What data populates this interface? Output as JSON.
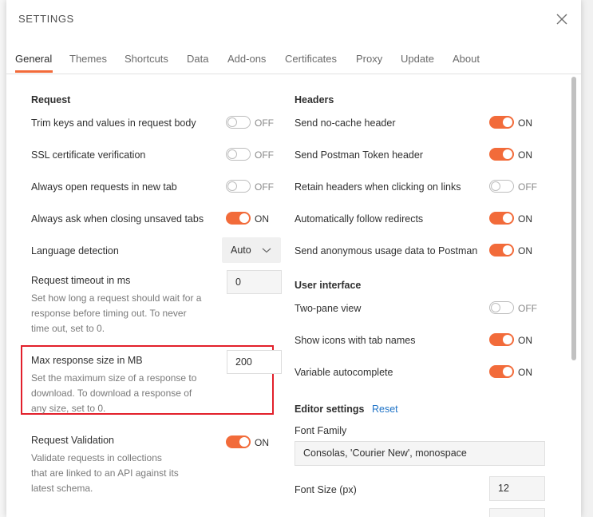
{
  "modal": {
    "title": "SETTINGS"
  },
  "tabs": [
    {
      "label": "General",
      "active": true
    },
    {
      "label": "Themes"
    },
    {
      "label": "Shortcuts"
    },
    {
      "label": "Data"
    },
    {
      "label": "Add-ons"
    },
    {
      "label": "Certificates"
    },
    {
      "label": "Proxy"
    },
    {
      "label": "Update"
    },
    {
      "label": "About"
    }
  ],
  "request": {
    "title": "Request",
    "trim_keys": {
      "label": "Trim keys and values in request body",
      "state": "OFF"
    },
    "ssl": {
      "label": "SSL certificate verification",
      "state": "OFF"
    },
    "new_tab": {
      "label": "Always open requests in new tab",
      "state": "OFF"
    },
    "ask_close": {
      "label": "Always ask when closing unsaved tabs",
      "state": "ON"
    },
    "language": {
      "label": "Language detection",
      "value": "Auto"
    },
    "timeout": {
      "label": "Request timeout in ms",
      "value": "0",
      "desc": [
        "Set how long a request should wait for a",
        "response before timing out. To never",
        "time out, set to 0."
      ]
    },
    "max_response": {
      "label": "Max response size in MB",
      "value": "200",
      "desc": [
        "Set the maximum size of a response to",
        "download. To download a response of",
        "any size, set to 0."
      ]
    },
    "validation": {
      "label": "Request Validation",
      "state": "ON",
      "desc": [
        "Validate requests in collections",
        "that are linked to an API against its",
        "latest schema."
      ]
    }
  },
  "headers": {
    "title": "Headers",
    "no_cache": {
      "label": "Send no-cache header",
      "state": "ON"
    },
    "postman_token": {
      "label": "Send Postman Token header",
      "state": "ON"
    },
    "retain": {
      "label": "Retain headers when clicking on links",
      "state": "OFF"
    },
    "redirects": {
      "label": "Automatically follow redirects",
      "state": "ON"
    },
    "anon_usage": {
      "label": "Send anonymous usage data to Postman",
      "state": "ON"
    }
  },
  "ui": {
    "title": "User interface",
    "two_pane": {
      "label": "Two-pane view",
      "state": "OFF"
    },
    "icons_tab": {
      "label": "Show icons with tab names",
      "state": "ON"
    },
    "var_auto": {
      "label": "Variable autocomplete",
      "state": "ON"
    }
  },
  "editor": {
    "title": "Editor settings",
    "reset_label": "Reset",
    "font_family": {
      "label": "Font Family",
      "value": "Consolas, 'Courier New', monospace"
    },
    "font_size": {
      "label": "Font Size (px)",
      "value": "12"
    }
  },
  "colors": {
    "accent": "#f26b3a",
    "link": "#1f73c7",
    "highlight": "#e2202b"
  }
}
